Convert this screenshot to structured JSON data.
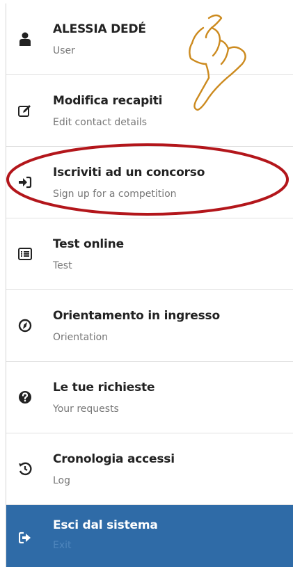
{
  "menu": {
    "items": [
      {
        "title": "ALESSIA DEDÉ",
        "subtitle": "User",
        "icon": "user-icon"
      },
      {
        "title": "Modifica recapiti",
        "subtitle": "Edit contact details",
        "icon": "edit-icon"
      },
      {
        "title": "Iscriviti ad un concorso",
        "subtitle": "Sign up for a competition",
        "icon": "sign-in-icon"
      },
      {
        "title": "Test online",
        "subtitle": "Test",
        "icon": "list-icon"
      },
      {
        "title": "Orientamento in ingresso",
        "subtitle": "Orientation",
        "icon": "compass-icon"
      },
      {
        "title": "Le tue richieste",
        "subtitle": "Your requests",
        "icon": "question-icon"
      },
      {
        "title": "Cronologia accessi",
        "subtitle": "Log",
        "icon": "history-icon"
      },
      {
        "title": "Esci dal sistema",
        "subtitle": "Exit",
        "icon": "sign-out-icon"
      }
    ]
  },
  "colors": {
    "active_bg": "#2f6ba7",
    "annotation_red": "#b3161b",
    "annotation_hand": "#cc8a1e"
  }
}
